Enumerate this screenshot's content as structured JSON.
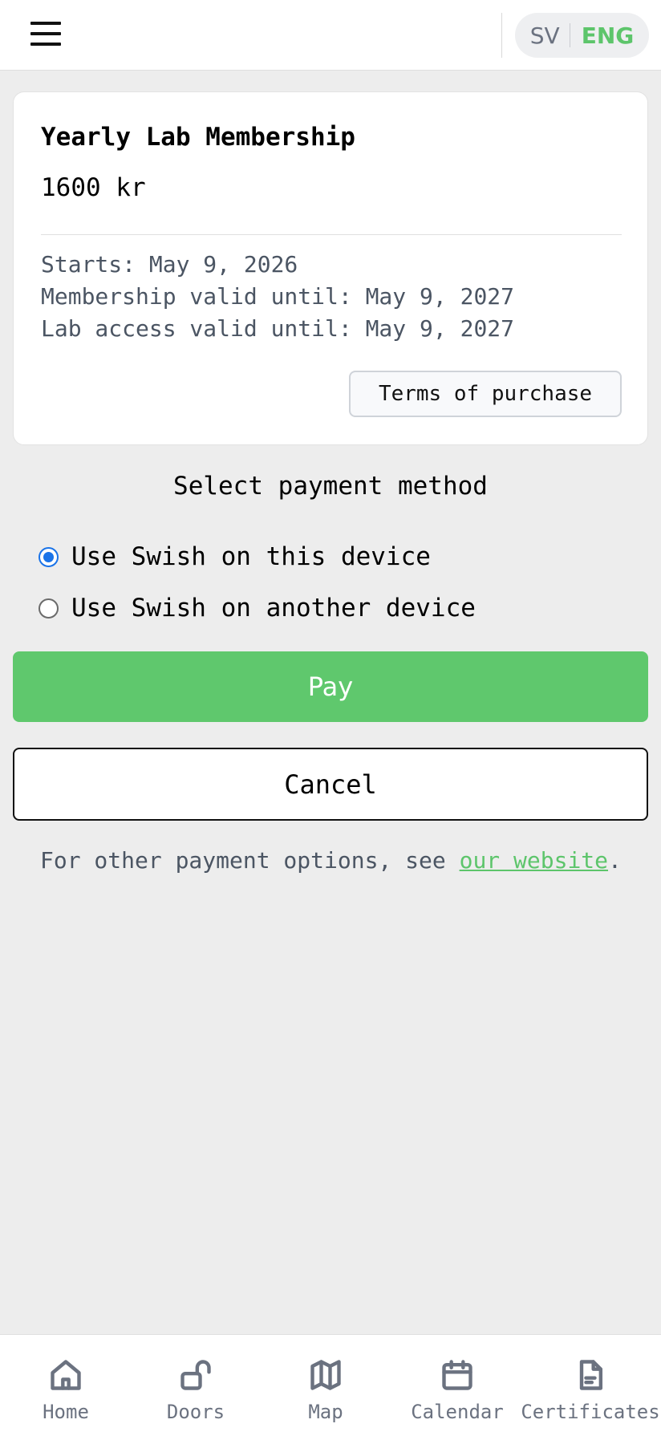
{
  "header": {
    "lang_sv": "SV",
    "lang_eng": "ENG",
    "active_language": "ENG",
    "accent_color": "#5dc56b"
  },
  "membership": {
    "title": "Yearly Lab Membership",
    "price": "1600 kr",
    "starts": "Starts: May 9, 2026",
    "membership_valid": "Membership valid until: May 9, 2027",
    "lab_access_valid": "Lab access valid until: May 9, 2027",
    "terms_label": "Terms of purchase"
  },
  "payment": {
    "section_title": "Select payment method",
    "options": [
      {
        "label": "Use Swish on this device",
        "selected": true
      },
      {
        "label": "Use Swish on another device",
        "selected": false
      }
    ],
    "pay_label": "Pay",
    "cancel_label": "Cancel",
    "other_text": "For other payment options, see ",
    "other_link": "our website",
    "other_suffix": "."
  },
  "bottom_nav": {
    "items": [
      {
        "label": "Home",
        "icon": "home-icon"
      },
      {
        "label": "Doors",
        "icon": "unlock-icon"
      },
      {
        "label": "Map",
        "icon": "map-icon"
      },
      {
        "label": "Calendar",
        "icon": "calendar-icon"
      },
      {
        "label": "Certificates",
        "icon": "document-icon"
      }
    ]
  }
}
